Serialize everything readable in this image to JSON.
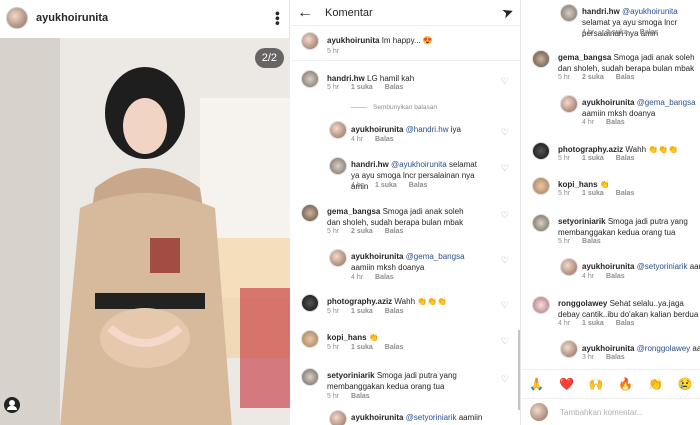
{
  "post": {
    "username": "ayukhoirunita",
    "counter": "2/2"
  },
  "header": {
    "title": "Komentar"
  },
  "comments_panel": [
    {
      "user": "ayukhoirunita",
      "text": "Im happy... 😍",
      "time": "5 hr",
      "likes": "",
      "reply": ""
    },
    {
      "user": "handri.hw",
      "text": "LG hamil kah",
      "time": "5 hr",
      "likes": "1 suka",
      "reply": "Balas"
    },
    {
      "hide": "Sembunyikan balasan"
    },
    {
      "user": "ayukhoirunita",
      "mention": "@handri.hw",
      "text": " iya",
      "time": "4 hr",
      "likes": "",
      "reply": "Balas"
    },
    {
      "user": "handri.hw",
      "mention": "@ayukhoirunita",
      "text": " selamat ya ayu smoga lncr persalainan nya amin",
      "time": "4 hr",
      "likes": "1 suka",
      "reply": "Balas"
    },
    {
      "user": "gema_bangsa",
      "text": "Smoga jadi anak soleh dan sholeh, sudah berapa bulan mbak",
      "time": "5 hr",
      "likes": "2 suka",
      "reply": "Balas"
    },
    {
      "user": "ayukhoirunita",
      "mention": "@gema_bangsa",
      "text": " aamiin mksh doanya",
      "time": "4 hr",
      "likes": "",
      "reply": "Balas"
    },
    {
      "user": "photography.aziz",
      "text": "Wahh 👏👏👏",
      "time": "5 hr",
      "likes": "1 suka",
      "reply": "Balas"
    },
    {
      "user": "kopi_hans",
      "text": "👏",
      "time": "5 hr",
      "likes": "1 suka",
      "reply": "Balas"
    },
    {
      "user": "setyoriniarik",
      "text": "Smoga jadi putra yang membanggakan kedua orang tua",
      "time": "5 hr",
      "likes": "",
      "reply": "Balas"
    },
    {
      "user": "ayukhoirunita",
      "mention": "@setyoriniarik",
      "text": " aamiin",
      "time": "",
      "likes": "",
      "reply": ""
    }
  ],
  "comments_panel3": [
    {
      "user": "",
      "mention": "@ayukhoirunita",
      "text": " selamat ya ayu smoga lncr persalainan nya amin",
      "pre": "handri.hw",
      "time": "4 hr",
      "likes": "1 suka",
      "reply": "Balas"
    },
    {
      "user": "gema_bangsa",
      "text": "Smoga jadi anak soleh dan sholeh, sudah berapa bulan mbak",
      "time": "5 hr",
      "likes": "2 suka",
      "reply": "Balas"
    },
    {
      "user": "ayukhoirunita",
      "mention": "@gema_bangsa",
      "text": " aamiin mksh doanya",
      "time": "4 hr",
      "likes": "",
      "reply": "Balas"
    },
    {
      "user": "photography.aziz",
      "text": "Wahh 👏👏👏",
      "time": "5 hr",
      "likes": "1 suka",
      "reply": "Balas"
    },
    {
      "user": "kopi_hans",
      "text": "👏",
      "time": "5 hr",
      "likes": "1 suka",
      "reply": "Balas"
    },
    {
      "user": "setyoriniarik",
      "text": "Smoga jadi putra yang membanggakan kedua orang tua",
      "time": "5 hr",
      "likes": "",
      "reply": "Balas"
    },
    {
      "user": "ayukhoirunita",
      "mention": "@setyoriniarik",
      "text": " aamiin",
      "time": "4 hr",
      "likes": "",
      "reply": "Balas"
    },
    {
      "user": "ronggolawey",
      "text": "Sehat selalu..ya.jaga debay cantik..ibu do'akan kalian berdua sehat s",
      "time": "4 hr",
      "likes": "1 suka",
      "reply": "Balas"
    },
    {
      "user": "ayukhoirunita",
      "mention": "@ronggolawey",
      "text": " aam",
      "time": "3 hr",
      "likes": "",
      "reply": "Balas"
    }
  ],
  "emoji_bar": [
    "🙏",
    "❤️",
    "🙌",
    "🔥",
    "👏",
    "😢"
  ],
  "add_comment": {
    "placeholder": "Tambahkan komentar..."
  }
}
